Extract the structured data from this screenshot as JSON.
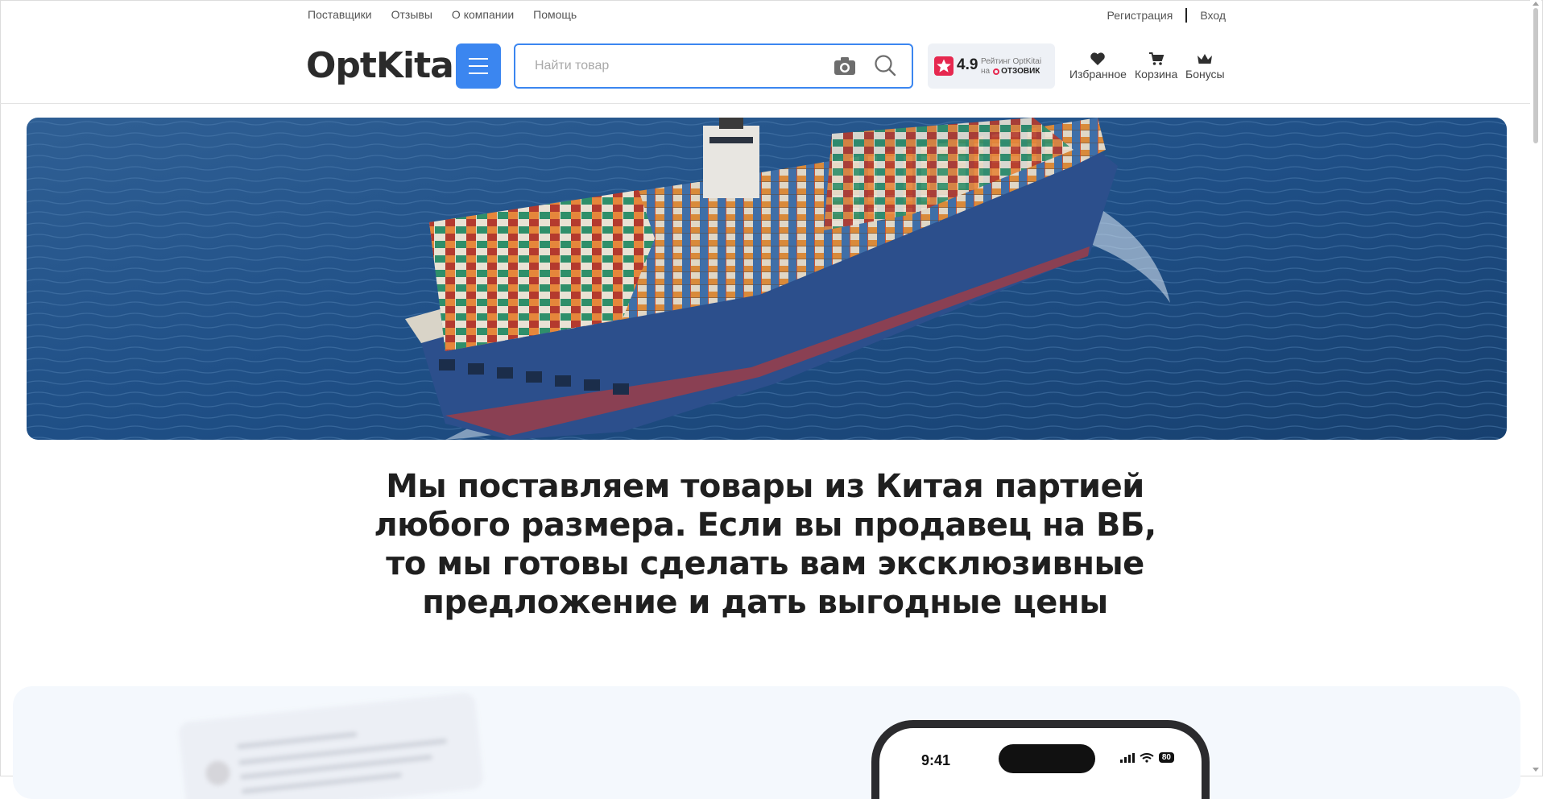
{
  "topnav": {
    "links": [
      "Поставщики",
      "Отзывы",
      "О компании",
      "Помощь"
    ],
    "register": "Регистрация",
    "login": "Вход"
  },
  "header": {
    "logo": "OptKitai",
    "search_placeholder": "Найти товар",
    "rating": {
      "score": "4.9",
      "line1": "Рейтинг OptKitai",
      "line2_prefix": "на",
      "brand": "ОТЗОВИК"
    },
    "icons": {
      "favorites": "Избранное",
      "cart": "Корзина",
      "bonuses": "Бонусы"
    }
  },
  "banner": {
    "image": "container-ship-aerial"
  },
  "headline": "Мы поставляем товары из Китая партией любого размера. Если вы продавец на ВБ, то мы готовы сделать вам эксклюзивные предложение и дать выгодные цены",
  "phone": {
    "time": "9:41",
    "battery": "80"
  },
  "colors": {
    "accent": "#3b86f0",
    "rating_red": "#e6284f",
    "panel_bg": "#f4f8fd"
  }
}
